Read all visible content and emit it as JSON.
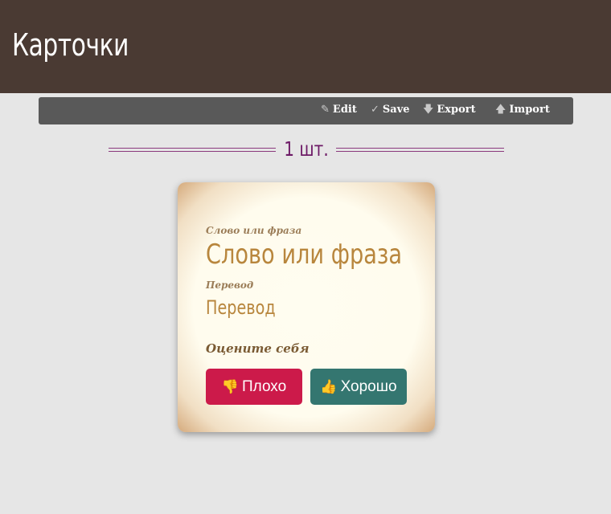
{
  "header": {
    "title": "Карточки"
  },
  "toolbar": {
    "edit": {
      "icon": "pencil-icon",
      "glyph": "✎",
      "label": "Edit"
    },
    "save": {
      "icon": "checkmark-icon",
      "glyph": "✓",
      "label": "Save"
    },
    "export": {
      "icon": "arrow-down-icon",
      "glyph": "🡇",
      "label": "Export"
    },
    "import": {
      "icon": "arrow-up-icon",
      "glyph": "🡅",
      "label": "Import"
    }
  },
  "counter": {
    "text": "1 шт."
  },
  "card": {
    "word_label": "Слово или фраза",
    "word_value": "Слово или фраза",
    "translation_label": "Перевод",
    "translation_value": "Перевод",
    "rate_prompt": "Оцените себя",
    "bad_button": {
      "icon": "thumbs-down-icon",
      "glyph": "👎",
      "label": "Плохо"
    },
    "good_button": {
      "icon": "thumbs-up-icon",
      "glyph": "👍",
      "label": "Хорошо"
    }
  },
  "colors": {
    "header_bg": "#4a3a33",
    "toolbar_bg": "#595959",
    "accent_purple": "#6d1a66",
    "card_text": "#b8863d",
    "bad": "#cc1a4a",
    "good": "#347670"
  }
}
